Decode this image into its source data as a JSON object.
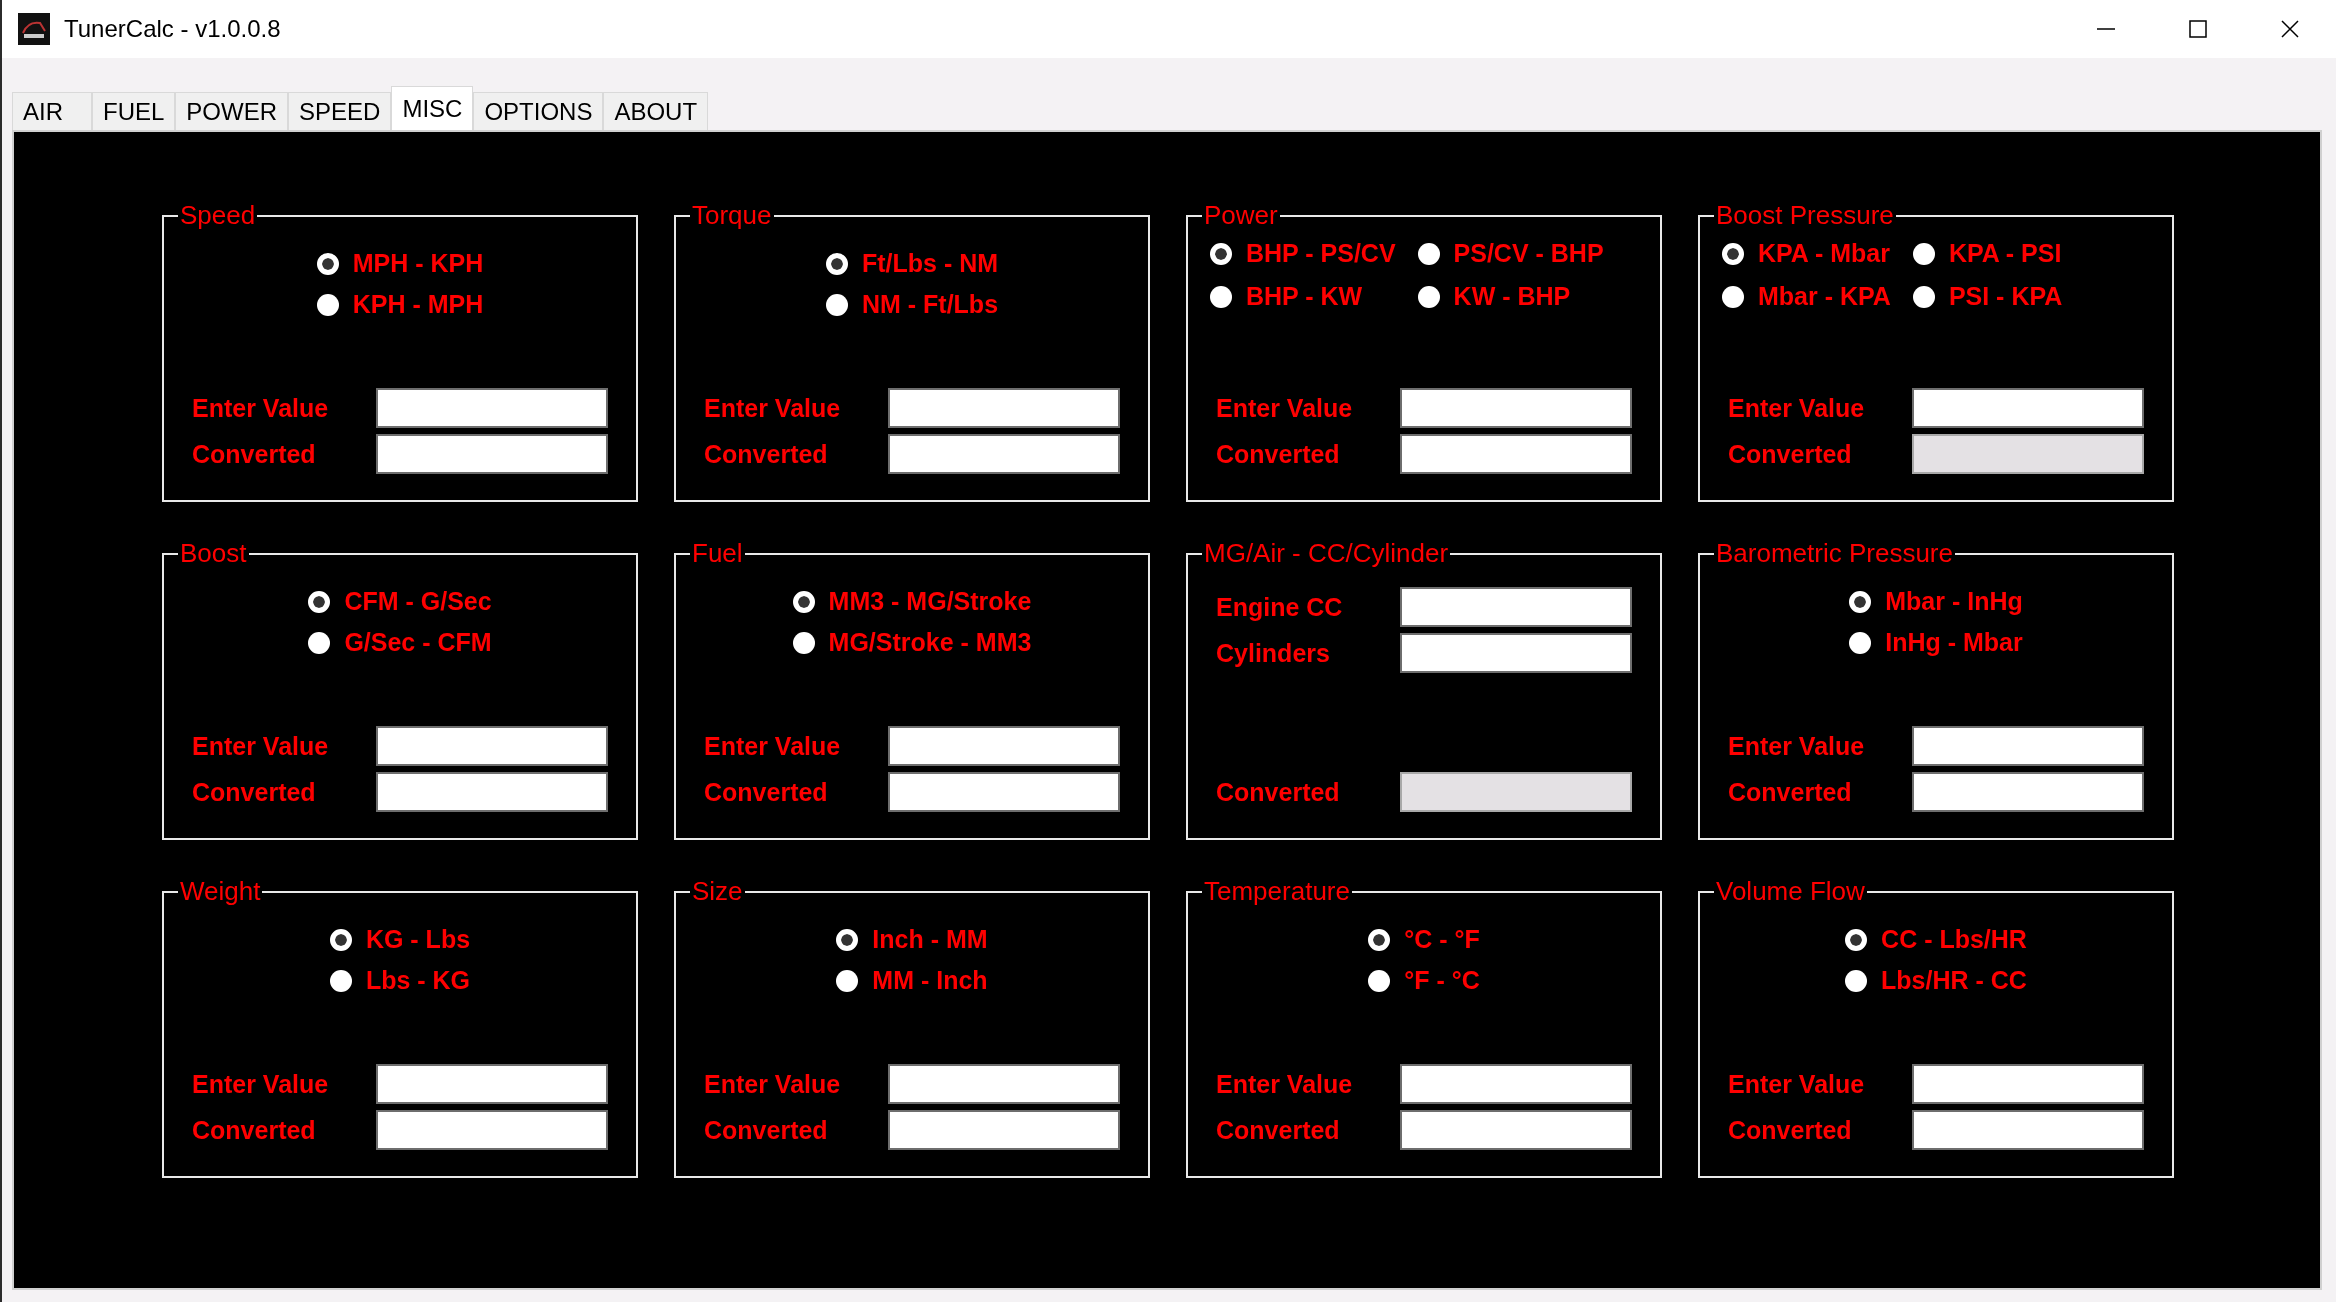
{
  "window": {
    "title": "TunerCalc - v1.0.0.8"
  },
  "tabs": [
    {
      "label": "AIR",
      "selected": false
    },
    {
      "label": "FUEL",
      "selected": false
    },
    {
      "label": "POWER",
      "selected": false
    },
    {
      "label": "SPEED",
      "selected": false
    },
    {
      "label": "MISC",
      "selected": true
    },
    {
      "label": "OPTIONS",
      "selected": false
    },
    {
      "label": "ABOUT",
      "selected": false
    }
  ],
  "groups": [
    {
      "title": "Speed",
      "options": [
        {
          "label": "MPH - KPH",
          "selected": true
        },
        {
          "label": "KPH - MPH",
          "selected": false
        }
      ],
      "fields": [
        {
          "label": "Enter Value",
          "kind": "input",
          "disabled": false
        },
        {
          "label": "Converted",
          "kind": "output",
          "disabled": false
        }
      ]
    },
    {
      "title": "Torque",
      "options": [
        {
          "label": "Ft/Lbs - NM",
          "selected": true
        },
        {
          "label": "NM - Ft/Lbs",
          "selected": false
        }
      ],
      "fields": [
        {
          "label": "Enter Value",
          "kind": "input",
          "disabled": false
        },
        {
          "label": "Converted",
          "kind": "output",
          "disabled": false
        }
      ]
    },
    {
      "title": "Power",
      "options": [
        {
          "label": "BHP - PS/CV",
          "selected": true
        },
        {
          "label": "PS/CV - BHP",
          "selected": false
        },
        {
          "label": "BHP - KW",
          "selected": false
        },
        {
          "label": "KW - BHP",
          "selected": false
        }
      ],
      "fields": [
        {
          "label": "Enter Value",
          "kind": "input",
          "disabled": false
        },
        {
          "label": "Converted",
          "kind": "output",
          "disabled": false
        }
      ]
    },
    {
      "title": "Boost Pressure",
      "options": [
        {
          "label": "KPA - Mbar",
          "selected": true
        },
        {
          "label": "KPA - PSI",
          "selected": false
        },
        {
          "label": "Mbar - KPA",
          "selected": false
        },
        {
          "label": "PSI - KPA",
          "selected": false
        }
      ],
      "fields": [
        {
          "label": "Enter Value",
          "kind": "input",
          "disabled": false
        },
        {
          "label": "Converted",
          "kind": "output",
          "disabled": true
        }
      ]
    },
    {
      "title": "Boost",
      "options": [
        {
          "label": "CFM - G/Sec",
          "selected": true
        },
        {
          "label": "G/Sec - CFM",
          "selected": false
        }
      ],
      "fields": [
        {
          "label": "Enter Value",
          "kind": "input",
          "disabled": false
        },
        {
          "label": "Converted",
          "kind": "output",
          "disabled": false
        }
      ]
    },
    {
      "title": "Fuel",
      "options": [
        {
          "label": "MM3 - MG/Stroke",
          "selected": true
        },
        {
          "label": "MG/Stroke - MM3",
          "selected": false
        }
      ],
      "fields": [
        {
          "label": "Enter Value",
          "kind": "input",
          "disabled": false
        },
        {
          "label": "Converted",
          "kind": "output",
          "disabled": false
        }
      ]
    },
    {
      "title": "MG/Air - CC/Cylinder",
      "fields": [
        {
          "label": "Engine CC",
          "kind": "input",
          "disabled": false
        },
        {
          "label": "Cylinders",
          "kind": "input",
          "disabled": false
        },
        {
          "label": "Converted",
          "kind": "output",
          "disabled": true
        }
      ]
    },
    {
      "title": "Barometric Pressure",
      "options": [
        {
          "label": "Mbar - InHg",
          "selected": true
        },
        {
          "label": "InHg - Mbar",
          "selected": false
        }
      ],
      "fields": [
        {
          "label": "Enter Value",
          "kind": "input",
          "disabled": false
        },
        {
          "label": "Converted",
          "kind": "output",
          "disabled": false
        }
      ]
    },
    {
      "title": "Weight",
      "options": [
        {
          "label": "KG - Lbs",
          "selected": true
        },
        {
          "label": "Lbs - KG",
          "selected": false
        }
      ],
      "fields": [
        {
          "label": "Enter Value",
          "kind": "input",
          "disabled": false
        },
        {
          "label": "Converted",
          "kind": "output",
          "disabled": false
        }
      ]
    },
    {
      "title": "Size",
      "options": [
        {
          "label": "Inch - MM",
          "selected": true
        },
        {
          "label": "MM - Inch",
          "selected": false
        }
      ],
      "fields": [
        {
          "label": "Enter Value",
          "kind": "input",
          "disabled": false
        },
        {
          "label": "Converted",
          "kind": "output",
          "disabled": false
        }
      ]
    },
    {
      "title": "Temperature",
      "options": [
        {
          "label": "°C - °F",
          "selected": true
        },
        {
          "label": "°F - °C",
          "selected": false
        }
      ],
      "fields": [
        {
          "label": "Enter Value",
          "kind": "input",
          "disabled": false
        },
        {
          "label": "Converted",
          "kind": "output",
          "disabled": false
        }
      ]
    },
    {
      "title": "Volume Flow",
      "options": [
        {
          "label": "CC - Lbs/HR",
          "selected": true
        },
        {
          "label": "Lbs/HR - CC",
          "selected": false
        }
      ],
      "fields": [
        {
          "label": "Enter Value",
          "kind": "input",
          "disabled": false
        },
        {
          "label": "Converted",
          "kind": "output",
          "disabled": false
        }
      ]
    }
  ]
}
